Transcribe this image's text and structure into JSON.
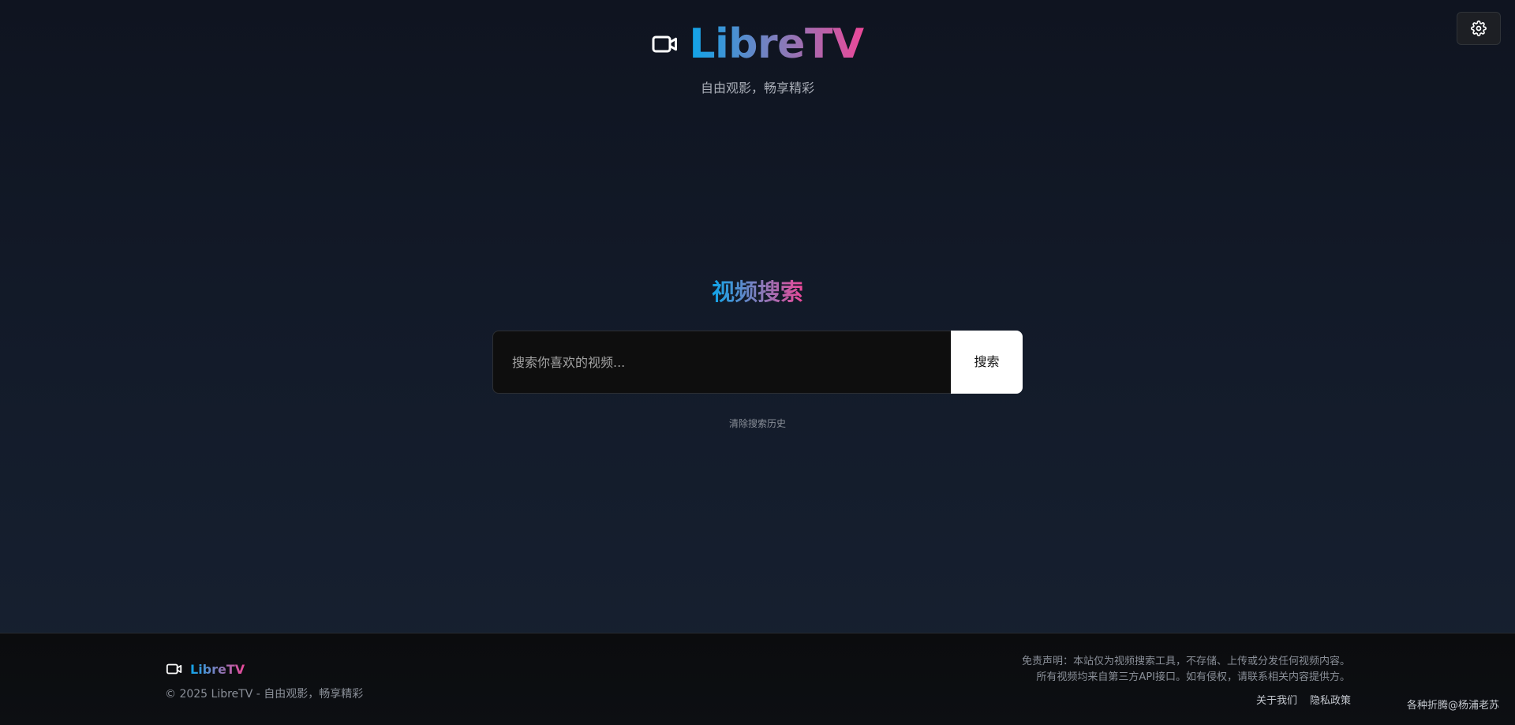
{
  "header": {
    "logo_text": "LibreTV",
    "tagline": "自由观影，畅享精彩"
  },
  "settings": {
    "icon": "gear-icon"
  },
  "search": {
    "title": "视频搜索",
    "placeholder": "搜索你喜欢的视频...",
    "button_label": "搜索",
    "clear_history": "清除搜索历史"
  },
  "footer": {
    "brand": "LibreTV",
    "copyright": "© 2025 LibreTV - 自由观影，畅享精彩",
    "disclaimer_line1": "免责声明：本站仅为视频搜索工具，不存储、上传或分发任何视频内容。",
    "disclaimer_line2": "所有视频均来自第三方API接口。如有侵权，请联系相关内容提供方。",
    "links": {
      "about": "关于我们",
      "privacy": "隐私政策"
    }
  },
  "credit": "各种折腾@杨浦老苏",
  "colors": {
    "background": "#131b2a",
    "gradient_start": "#0ea5e9",
    "gradient_end": "#ec4899",
    "search_button_bg": "#ffffff",
    "footer_bg": "#0b0c0e"
  }
}
